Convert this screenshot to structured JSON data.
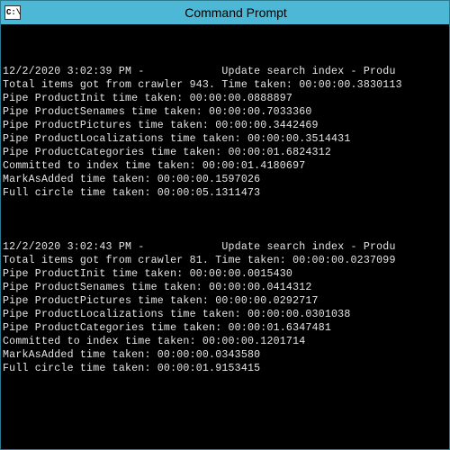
{
  "titlebar": {
    "title": "Command Prompt",
    "icon_symbol": "C:\\"
  },
  "blocks": [
    {
      "timestamp": "12/2/2020 3:02:39 PM",
      "redacted": "          ",
      "header_suffix": " Update search index - Produ",
      "lines": [
        "Total items got from crawler 943. Time taken: 00:00:00.3830113",
        "Pipe ProductInit time taken: 00:00:00.0888897",
        "Pipe ProductSenames time taken: 00:00:00.7033360",
        "Pipe ProductPictures time taken: 00:00:00.3442469",
        "Pipe ProductLocalizations time taken: 00:00:00.3514431",
        "Pipe ProductCategories time taken: 00:00:01.6824312",
        "Committed to index time taken: 00:00:01.4180697",
        "MarkAsAdded time taken: 00:00:00.1597026",
        "Full circle time taken: 00:00:05.1311473"
      ]
    },
    {
      "timestamp": "12/2/2020 3:02:43 PM",
      "redacted": "          ",
      "header_suffix": " Update search index - Produ",
      "lines": [
        "Total items got from crawler 81. Time taken: 00:00:00.0237099",
        "Pipe ProductInit time taken: 00:00:00.0015430",
        "Pipe ProductSenames time taken: 00:00:00.0414312",
        "Pipe ProductPictures time taken: 00:00:00.0292717",
        "Pipe ProductLocalizations time taken: 00:00:00.0301038",
        "Pipe ProductCategories time taken: 00:00:01.6347481",
        "Committed to index time taken: 00:00:00.1201714",
        "MarkAsAdded time taken: 00:00:00.0343580",
        "Full circle time taken: 00:00:01.9153415"
      ]
    }
  ]
}
